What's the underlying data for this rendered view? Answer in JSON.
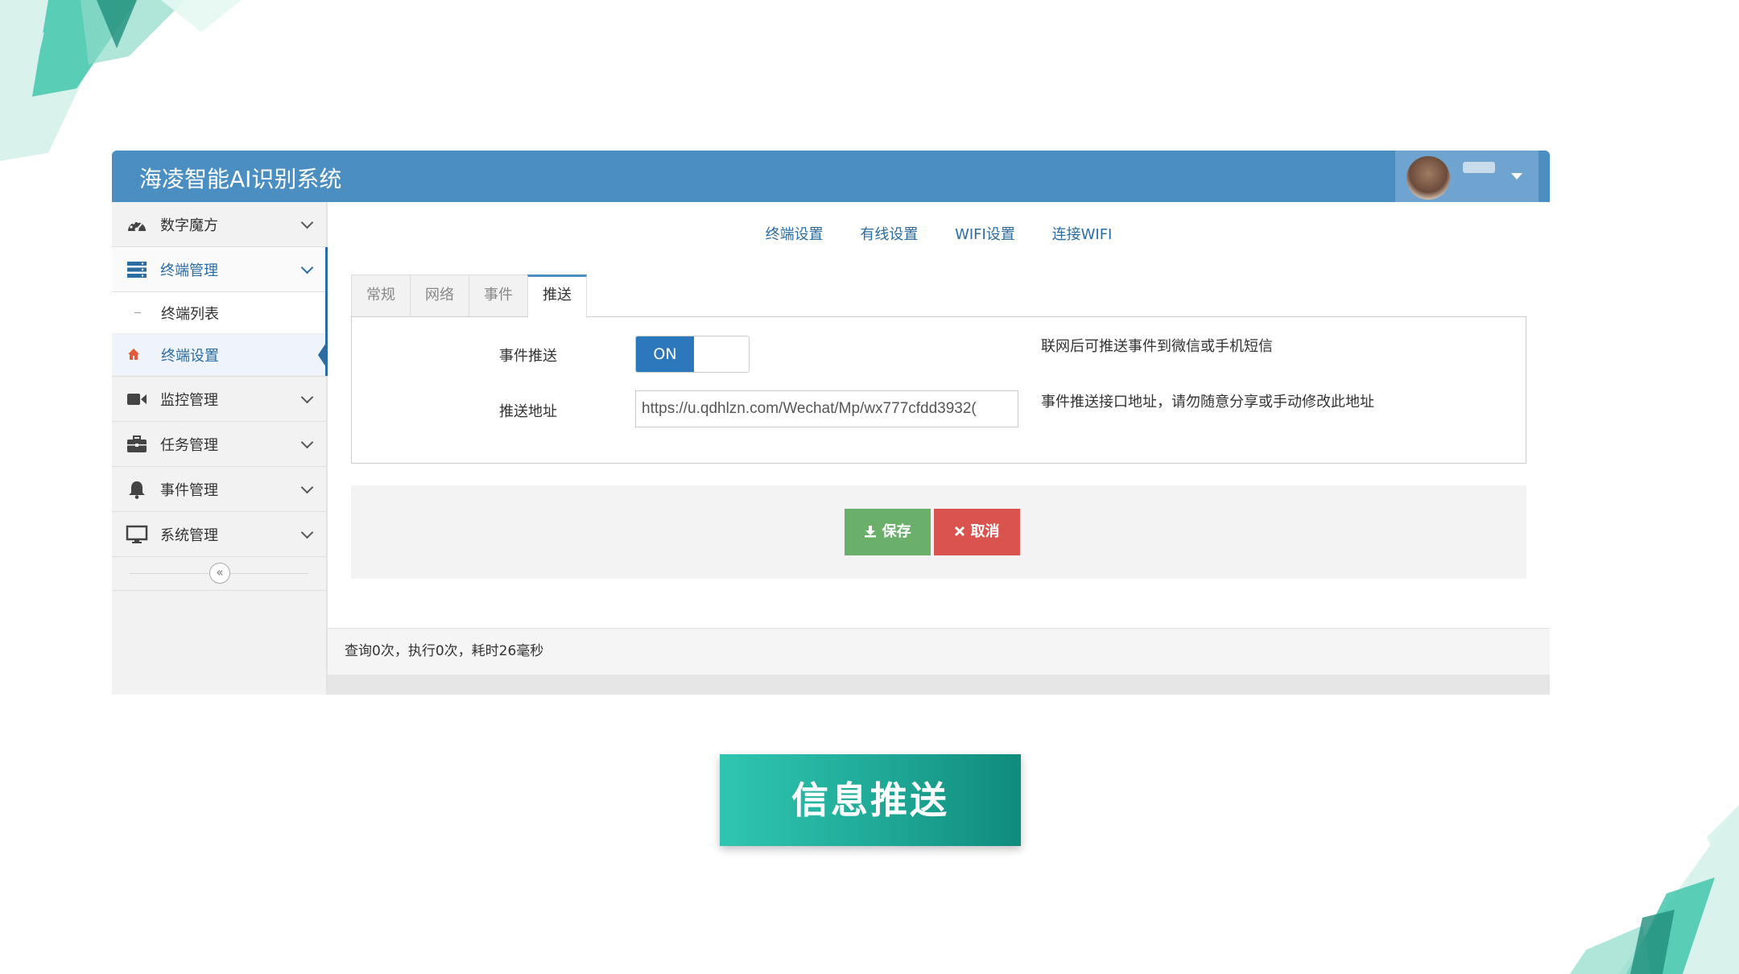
{
  "app": {
    "title": "海凌智能AI识别系统"
  },
  "sidebar": {
    "items": [
      {
        "label": "数字魔方",
        "icon": "dashboard-icon"
      },
      {
        "label": "终端管理",
        "icon": "server-icon"
      },
      {
        "label": "监控管理",
        "icon": "video-camera-icon"
      },
      {
        "label": "任务管理",
        "icon": "briefcase-icon"
      },
      {
        "label": "事件管理",
        "icon": "bell-icon"
      },
      {
        "label": "系统管理",
        "icon": "monitor-icon"
      }
    ],
    "sub_items": [
      {
        "label": "终端列表"
      },
      {
        "label": "终端设置",
        "icon": "home-icon"
      }
    ],
    "collapse_symbol": "«"
  },
  "main": {
    "top_links": [
      "终端设置",
      "有线设置",
      "WIFI设置",
      "连接WIFI"
    ],
    "tabs": [
      "常规",
      "网络",
      "事件",
      "推送"
    ],
    "active_tab": "推送",
    "form": {
      "push_label": "事件推送",
      "toggle_state": "ON",
      "push_hint": "联网后可推送事件到微信或手机短信",
      "url_label": "推送地址",
      "url_value": "https://u.qdhlzn.com/Wechat/Mp/wx777cfdd3932(",
      "url_hint": "事件推送接口地址，请勿随意分享或手动修改此地址"
    },
    "buttons": {
      "save": "保存",
      "cancel": "取消"
    },
    "status": "查询0次，执行0次，耗时26毫秒"
  },
  "caption": "信息推送",
  "colors": {
    "header": "#4a8ec2",
    "link": "#2b6ca3",
    "toggle_on": "#2d78bd",
    "save": "#6ab06a",
    "cancel": "#d9534f",
    "caption": "#1fa896"
  }
}
